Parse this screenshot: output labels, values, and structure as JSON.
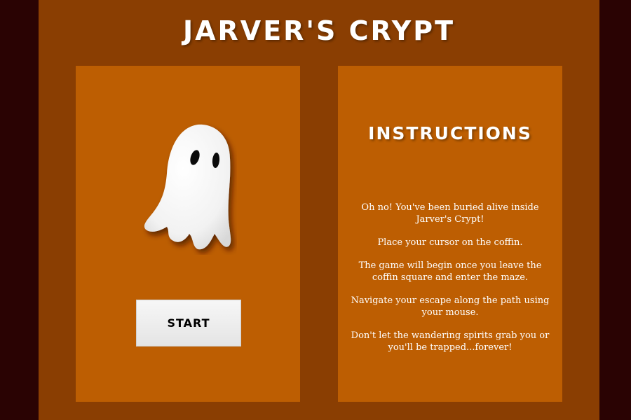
{
  "game": {
    "title": "Jarver's Crypt"
  },
  "left_panel": {
    "ghost_icon": "ghost-icon",
    "start_label": "START"
  },
  "instructions": {
    "heading": "Instructions",
    "lines": [
      "Oh no! You've been buried alive inside Jarver's Crypt!",
      "Place your cursor on the coffin.",
      "The game will begin once you leave the coffin square and enter the maze.",
      "Navigate your escape along the path using your mouse.",
      "Don't let the wandering spirits grab you or you'll be trapped...forever!"
    ]
  },
  "colors": {
    "outer_background": "#2a0303",
    "frame": "#8a3e02",
    "panel": "#bd5e02",
    "text": "#ffffff",
    "button": "#eeeeee"
  }
}
